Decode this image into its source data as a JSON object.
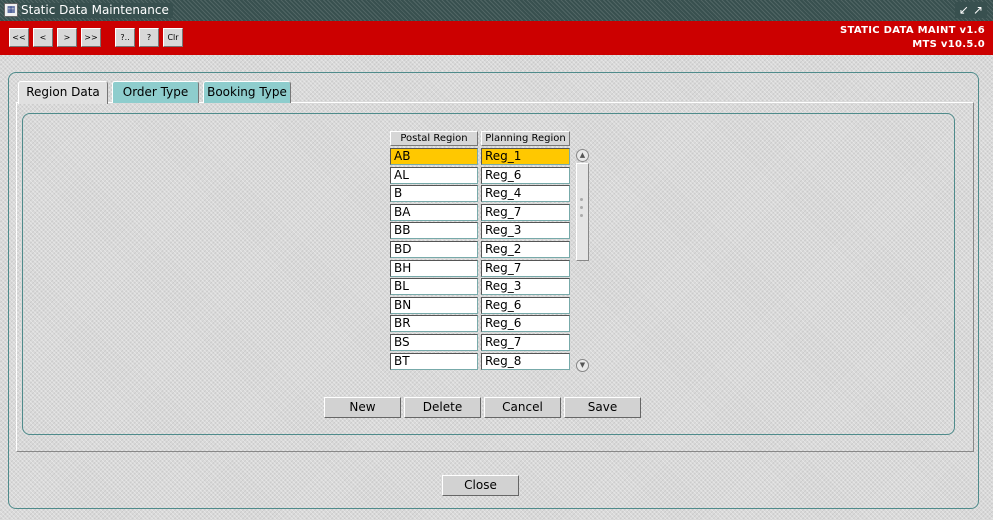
{
  "window": {
    "title": "Static Data Maintenance",
    "controls": "↙↗",
    "app_icon_glyph": "▦"
  },
  "toolbar": {
    "buttons": [
      "<<",
      "<",
      ">",
      ">>",
      "?..",
      "?",
      "Clr"
    ],
    "version_line1": "STATIC DATA MAINT v1.6",
    "version_line2": "MTS v10.5.0"
  },
  "tabs": [
    {
      "label": "Region Data",
      "active": true
    },
    {
      "label": "Order Type",
      "active": false
    },
    {
      "label": "Booking Type",
      "active": false
    }
  ],
  "grid": {
    "columns": [
      "Postal Region",
      "Planning Region"
    ],
    "rows": [
      [
        "AB",
        "Reg_1"
      ],
      [
        "AL",
        "Reg_6"
      ],
      [
        "B",
        "Reg_4"
      ],
      [
        "BA",
        "Reg_7"
      ],
      [
        "BB",
        "Reg_3"
      ],
      [
        "BD",
        "Reg_2"
      ],
      [
        "BH",
        "Reg_7"
      ],
      [
        "BL",
        "Reg_3"
      ],
      [
        "BN",
        "Reg_6"
      ],
      [
        "BR",
        "Reg_6"
      ],
      [
        "BS",
        "Reg_7"
      ],
      [
        "BT",
        "Reg_8"
      ]
    ],
    "selected_row": 0,
    "scroll_up_glyph": "▲",
    "scroll_down_glyph": "▼"
  },
  "actions": {
    "new": "New",
    "delete": "Delete",
    "cancel": "Cancel",
    "save": "Save"
  },
  "footer": {
    "close": "Close"
  },
  "colors": {
    "toolbar": "#cc0000",
    "titlebar": "#38504f",
    "selected_row": "#ffc800",
    "inactive_tab": "#8ecdcd",
    "frame": "#4e8b8b"
  }
}
